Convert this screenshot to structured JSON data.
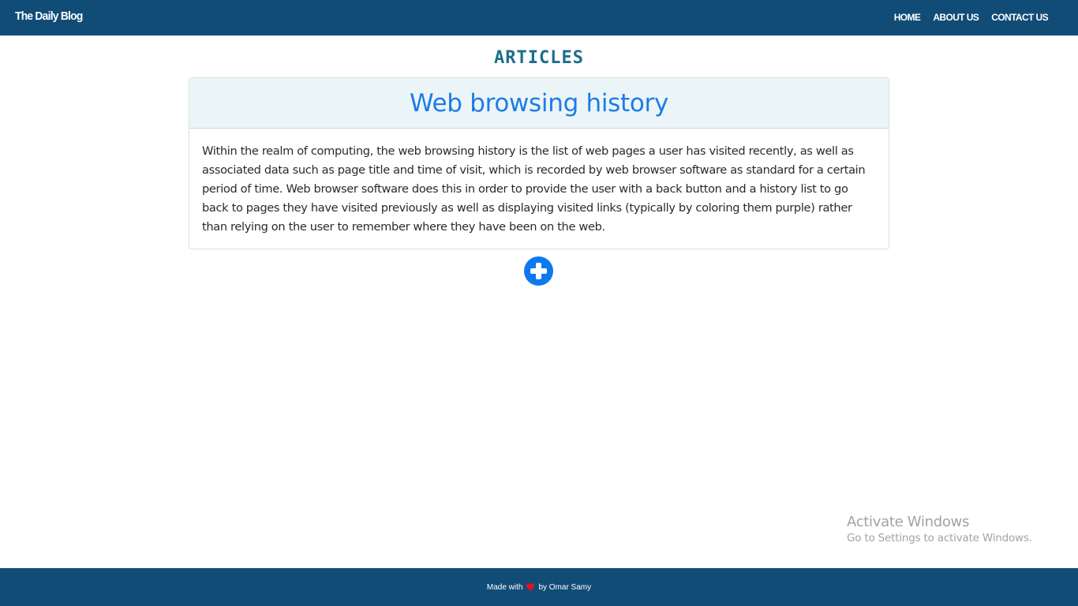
{
  "navbar": {
    "brand": "The Daily Blog",
    "links": [
      "HOME",
      "ABOUT US",
      "CONTACT US"
    ]
  },
  "main": {
    "heading": "ARTICLES",
    "article": {
      "title": "Web browsing history",
      "body": "Within the realm of computing, the web browsing history is the list of web pages a user has visited recently, as well as associated data such as page title and time of visit, which is recorded by web browser software as standard for a certain period of time. Web browser software does this in order to provide the user with a back button and a history list to go back to pages they have visited previously as well as displaying visited links (typically by coloring them purple) rather than relying on the user to remember where they have been on the web."
    },
    "add_button_icon": "plus-circle-icon"
  },
  "watermark": {
    "title": "Activate Windows",
    "subtitle": "Go to Settings to activate Windows."
  },
  "footer": {
    "made_with": "Made with",
    "by": "by Omar Samy",
    "heart_icon": "heart-icon"
  },
  "colors": {
    "navbar": "#114c77",
    "heading": "#1c6e8c",
    "title": "#1e7be6",
    "add_button": "#0d79f0",
    "heart": "#e0131f"
  }
}
